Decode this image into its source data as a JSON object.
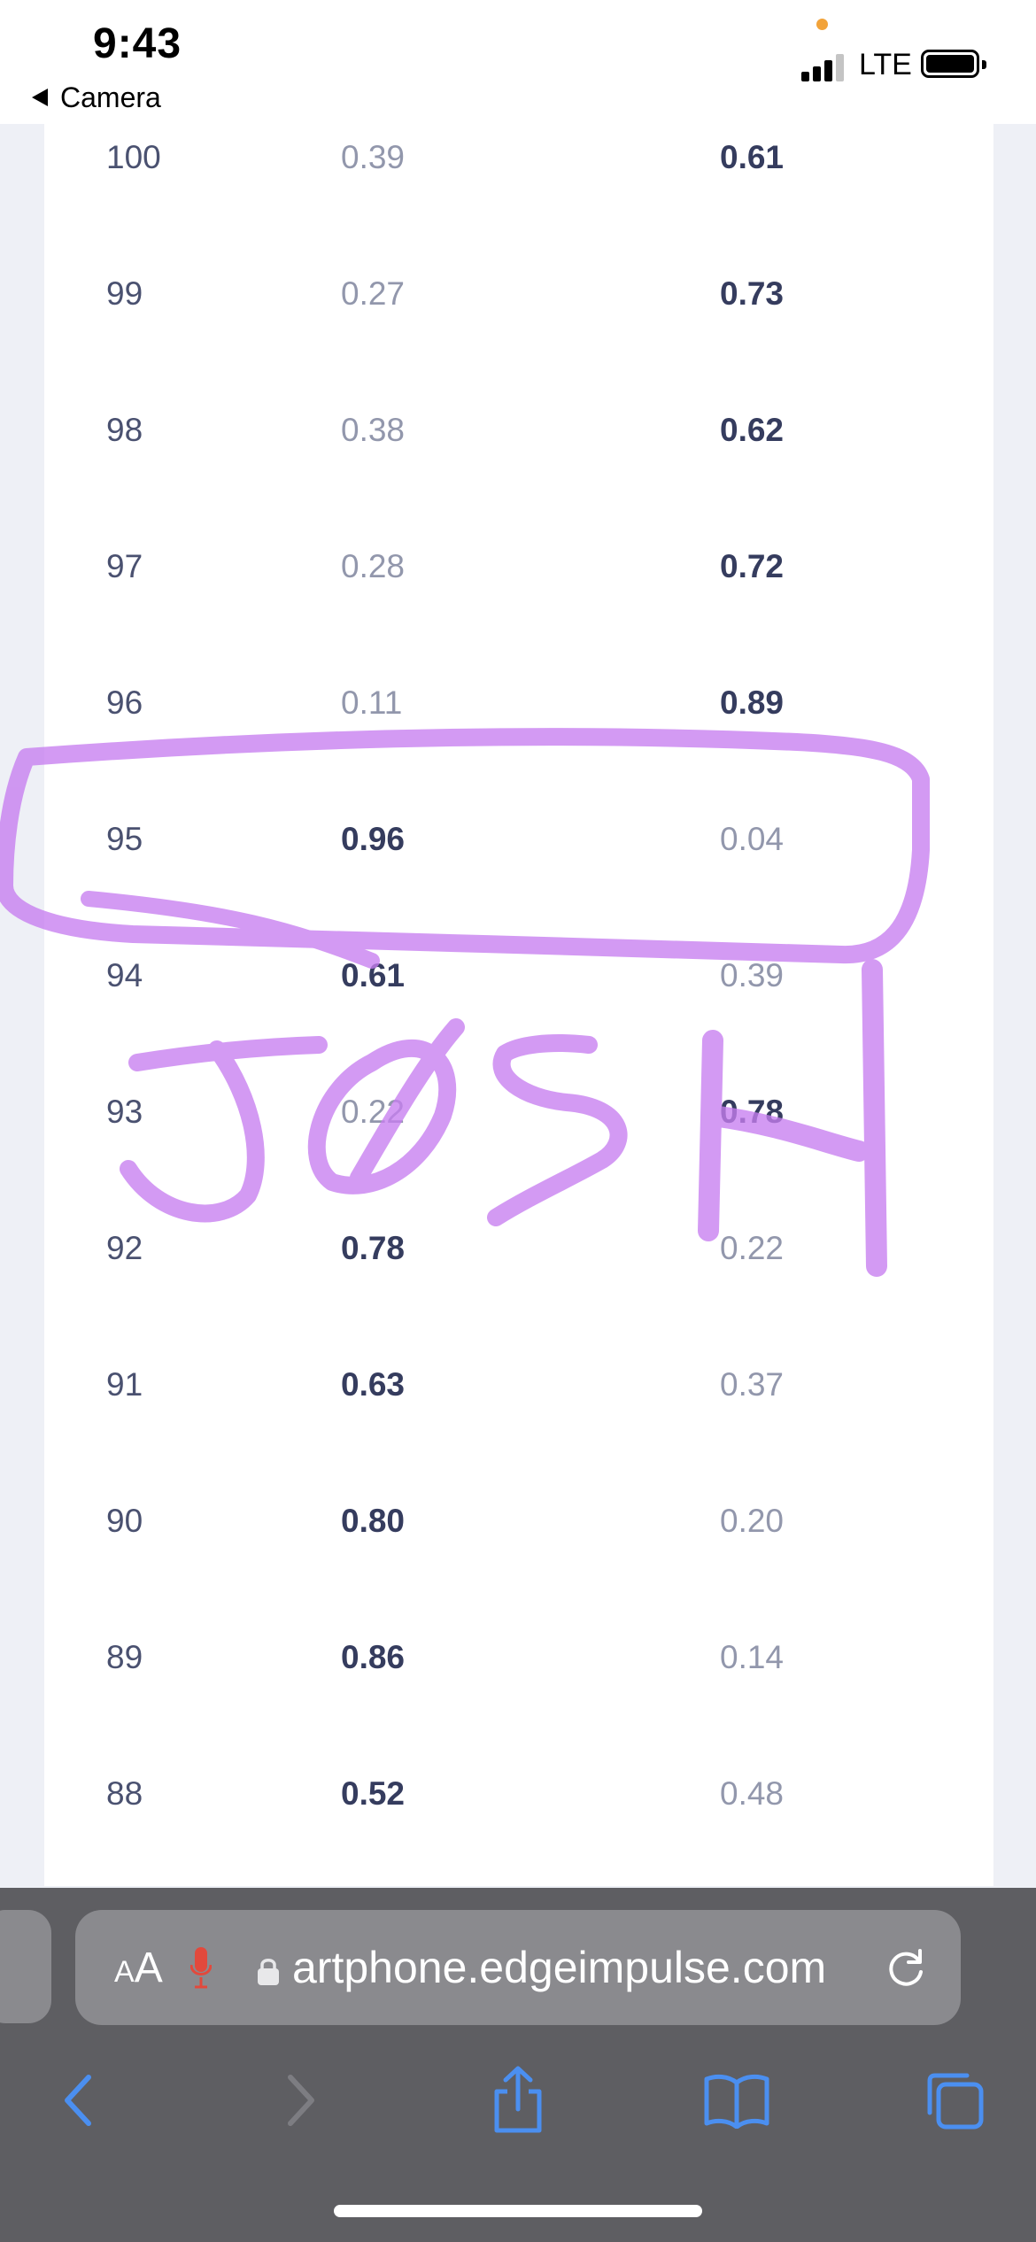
{
  "status_bar": {
    "time": "9:43",
    "back_app": "Camera",
    "network": "LTE"
  },
  "table": {
    "rows": [
      {
        "index": "100",
        "a": "0.39",
        "b": "0.61",
        "strong": "b"
      },
      {
        "index": "99",
        "a": "0.27",
        "b": "0.73",
        "strong": "b"
      },
      {
        "index": "98",
        "a": "0.38",
        "b": "0.62",
        "strong": "b"
      },
      {
        "index": "97",
        "a": "0.28",
        "b": "0.72",
        "strong": "b"
      },
      {
        "index": "96",
        "a": "0.11",
        "b": "0.89",
        "strong": "b"
      },
      {
        "index": "95",
        "a": "0.96",
        "b": "0.04",
        "strong": "a"
      },
      {
        "index": "94",
        "a": "0.61",
        "b": "0.39",
        "strong": "a"
      },
      {
        "index": "93",
        "a": "0.22",
        "b": "0.78",
        "strong": "b"
      },
      {
        "index": "92",
        "a": "0.78",
        "b": "0.22",
        "strong": "a"
      },
      {
        "index": "91",
        "a": "0.63",
        "b": "0.37",
        "strong": "a"
      },
      {
        "index": "90",
        "a": "0.80",
        "b": "0.20",
        "strong": "a"
      },
      {
        "index": "89",
        "a": "0.86",
        "b": "0.14",
        "strong": "a"
      },
      {
        "index": "88",
        "a": "0.52",
        "b": "0.48",
        "strong": "a"
      }
    ]
  },
  "annotation": {
    "handwriting": "JOSH",
    "color": "#c77ef0"
  },
  "browser": {
    "aa_label_small": "A",
    "aa_label_large": "A",
    "url": "artphone.edgeimpulse.com",
    "accent": "#4b8ff0"
  },
  "icons": {
    "mic": "mic-icon",
    "lock": "lock-icon",
    "reload": "reload-icon",
    "back": "chevron-left-icon",
    "forward": "chevron-right-icon",
    "share": "share-icon",
    "bookmarks": "book-icon",
    "tabs": "tabs-icon"
  }
}
